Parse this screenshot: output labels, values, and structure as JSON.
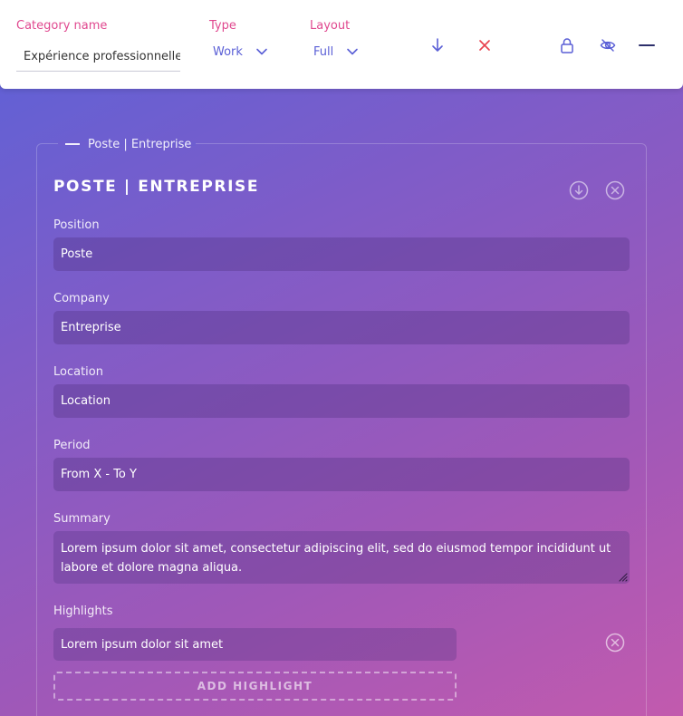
{
  "topbar": {
    "category_label": "Category name",
    "category_value": "Expérience professionnelle",
    "type_label": "Type",
    "type_value": "Work",
    "layout_label": "Layout",
    "layout_value": "Full",
    "icons": [
      "arrow-down-icon",
      "close-icon",
      "lock-icon",
      "eye-off-icon",
      "minus-icon"
    ],
    "accent_pink": "#e0488f",
    "accent_blue": "#5a5fd6",
    "accent_red": "#e8424f"
  },
  "card": {
    "legend": "Poste | Entreprise",
    "title": "POSTE | ENTREPRISE",
    "fields": {
      "position": {
        "label": "Position",
        "value": "Poste"
      },
      "company": {
        "label": "Company",
        "value": "Entreprise"
      },
      "location": {
        "label": "Location",
        "value": "Location"
      },
      "period": {
        "label": "Period",
        "value": "From X - To Y"
      },
      "summary": {
        "label": "Summary",
        "value": "Lorem ipsum dolor sit amet, consectetur adipiscing elit, sed do eiusmod tempor incididunt ut labore et dolore magna aliqua."
      }
    },
    "highlights": {
      "label": "Highlights",
      "items": [
        "Lorem ipsum dolor sit amet"
      ],
      "add_label": "ADD HIGHLIGHT"
    }
  }
}
